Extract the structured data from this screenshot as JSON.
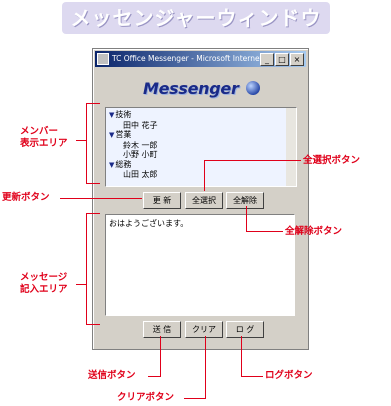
{
  "banner": {
    "title": "メッセンジャーウィンドウ"
  },
  "window": {
    "title": "TC Office Messenger - Microsoft Internet ...",
    "minimize_glyph": "_",
    "maximize_glyph": "□",
    "close_glyph": "×"
  },
  "logo": {
    "text": "Messenger"
  },
  "member_list": {
    "groups": [
      {
        "name": "技術",
        "members": [
          "田中 花子"
        ]
      },
      {
        "name": "営業",
        "members": [
          "鈴木 一郎",
          "小野 小町"
        ]
      },
      {
        "name": "総務",
        "members": [
          "山田 太郎"
        ]
      }
    ]
  },
  "buttons": {
    "refresh": "更 新",
    "select_all": "全選択",
    "deselect_all": "全解除",
    "send": "送 信",
    "clear": "クリア",
    "log": "ロ グ"
  },
  "message": {
    "text": "おはようございます。"
  },
  "annotations": {
    "member_area": [
      "メンバー",
      "表示エリア"
    ],
    "select_all_button": "全選択ボタン",
    "refresh_button": "更新ボタン",
    "deselect_all_button": "全解除ボタン",
    "message_area": [
      "メッセージ",
      "記入エリア"
    ],
    "send_button": "送信ボタン",
    "log_button": "ログボタン",
    "clear_button": "クリアボタン"
  },
  "colors": {
    "annotation": "#e0001a",
    "banner_bg": "#ddd9f0",
    "titlebar": "#0a246a",
    "logo": "#1a2a88"
  }
}
